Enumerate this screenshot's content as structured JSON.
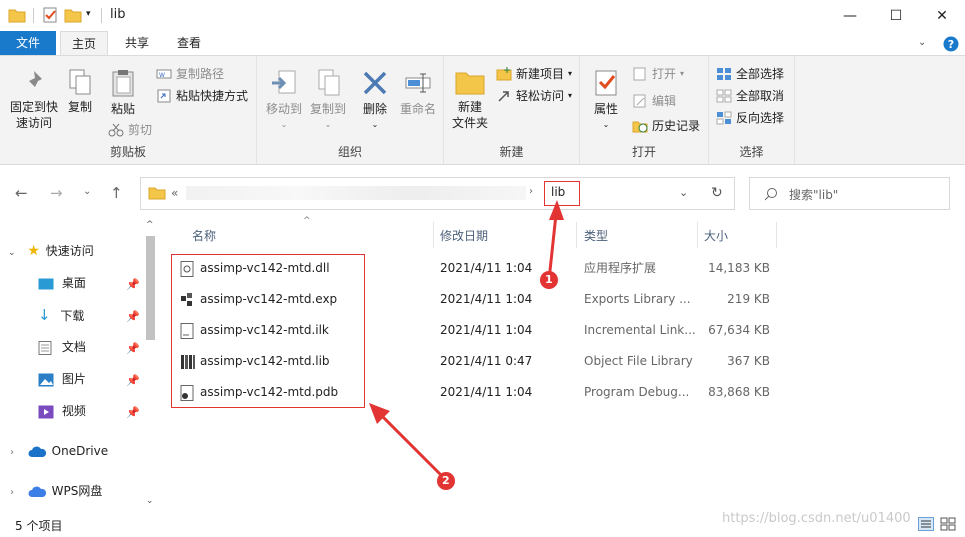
{
  "window": {
    "title": "lib",
    "minimize": "—",
    "maximize": "☐",
    "close": "✕"
  },
  "tabs": [
    "文件",
    "主页",
    "共享",
    "查看"
  ],
  "ribbon": {
    "clipboard": {
      "pin": "固定到快\n速访问",
      "copy": "复制",
      "paste": "粘贴",
      "copy_path": "复制路径",
      "paste_shortcut": "粘贴快捷方式",
      "cut": "剪切",
      "label": "剪贴板"
    },
    "organize": {
      "move_to": "移动到",
      "copy_to": "复制到",
      "delete": "删除",
      "rename": "重命名",
      "label": "组织"
    },
    "new": {
      "new_folder": "新建\n文件夹",
      "new_item": "新建项目",
      "easy_access": "轻松访问",
      "label": "新建"
    },
    "open": {
      "properties": "属性",
      "open": "打开",
      "edit": "编辑",
      "history": "历史记录",
      "label": "打开"
    },
    "select": {
      "select_all": "全部选择",
      "select_none": "全部取消",
      "invert": "反向选择",
      "label": "选择"
    }
  },
  "address": {
    "prefix": "«",
    "current": "lib"
  },
  "search": {
    "placeholder": "搜索\"lib\""
  },
  "nav": {
    "quick_access": "快速访问",
    "items": [
      "桌面",
      "下载",
      "文档",
      "图片",
      "视频"
    ],
    "onedrive": "OneDrive",
    "wps": "WPS网盘"
  },
  "columns": {
    "name": "名称",
    "modified": "修改日期",
    "type": "类型",
    "size": "大小"
  },
  "files": [
    {
      "name": "assimp-vc142-mtd.dll",
      "modified": "2021/4/11 1:04",
      "type": "应用程序扩展",
      "size": "14,183 KB"
    },
    {
      "name": "assimp-vc142-mtd.exp",
      "modified": "2021/4/11 1:04",
      "type": "Exports Library ...",
      "size": "219 KB"
    },
    {
      "name": "assimp-vc142-mtd.ilk",
      "modified": "2021/4/11 1:04",
      "type": "Incremental Link...",
      "size": "67,634 KB"
    },
    {
      "name": "assimp-vc142-mtd.lib",
      "modified": "2021/4/11 0:47",
      "type": "Object File Library",
      "size": "367 KB"
    },
    {
      "name": "assimp-vc142-mtd.pdb",
      "modified": "2021/4/11 1:04",
      "type": "Program Debug...",
      "size": "83,868 KB"
    }
  ],
  "status": {
    "count": "5 个项目"
  },
  "annotations": {
    "one": "1",
    "two": "2"
  },
  "watermark": "https://blog.csdn.net/u01400",
  "colors": {
    "accent": "#1979ca",
    "annotation": "#e33434"
  }
}
